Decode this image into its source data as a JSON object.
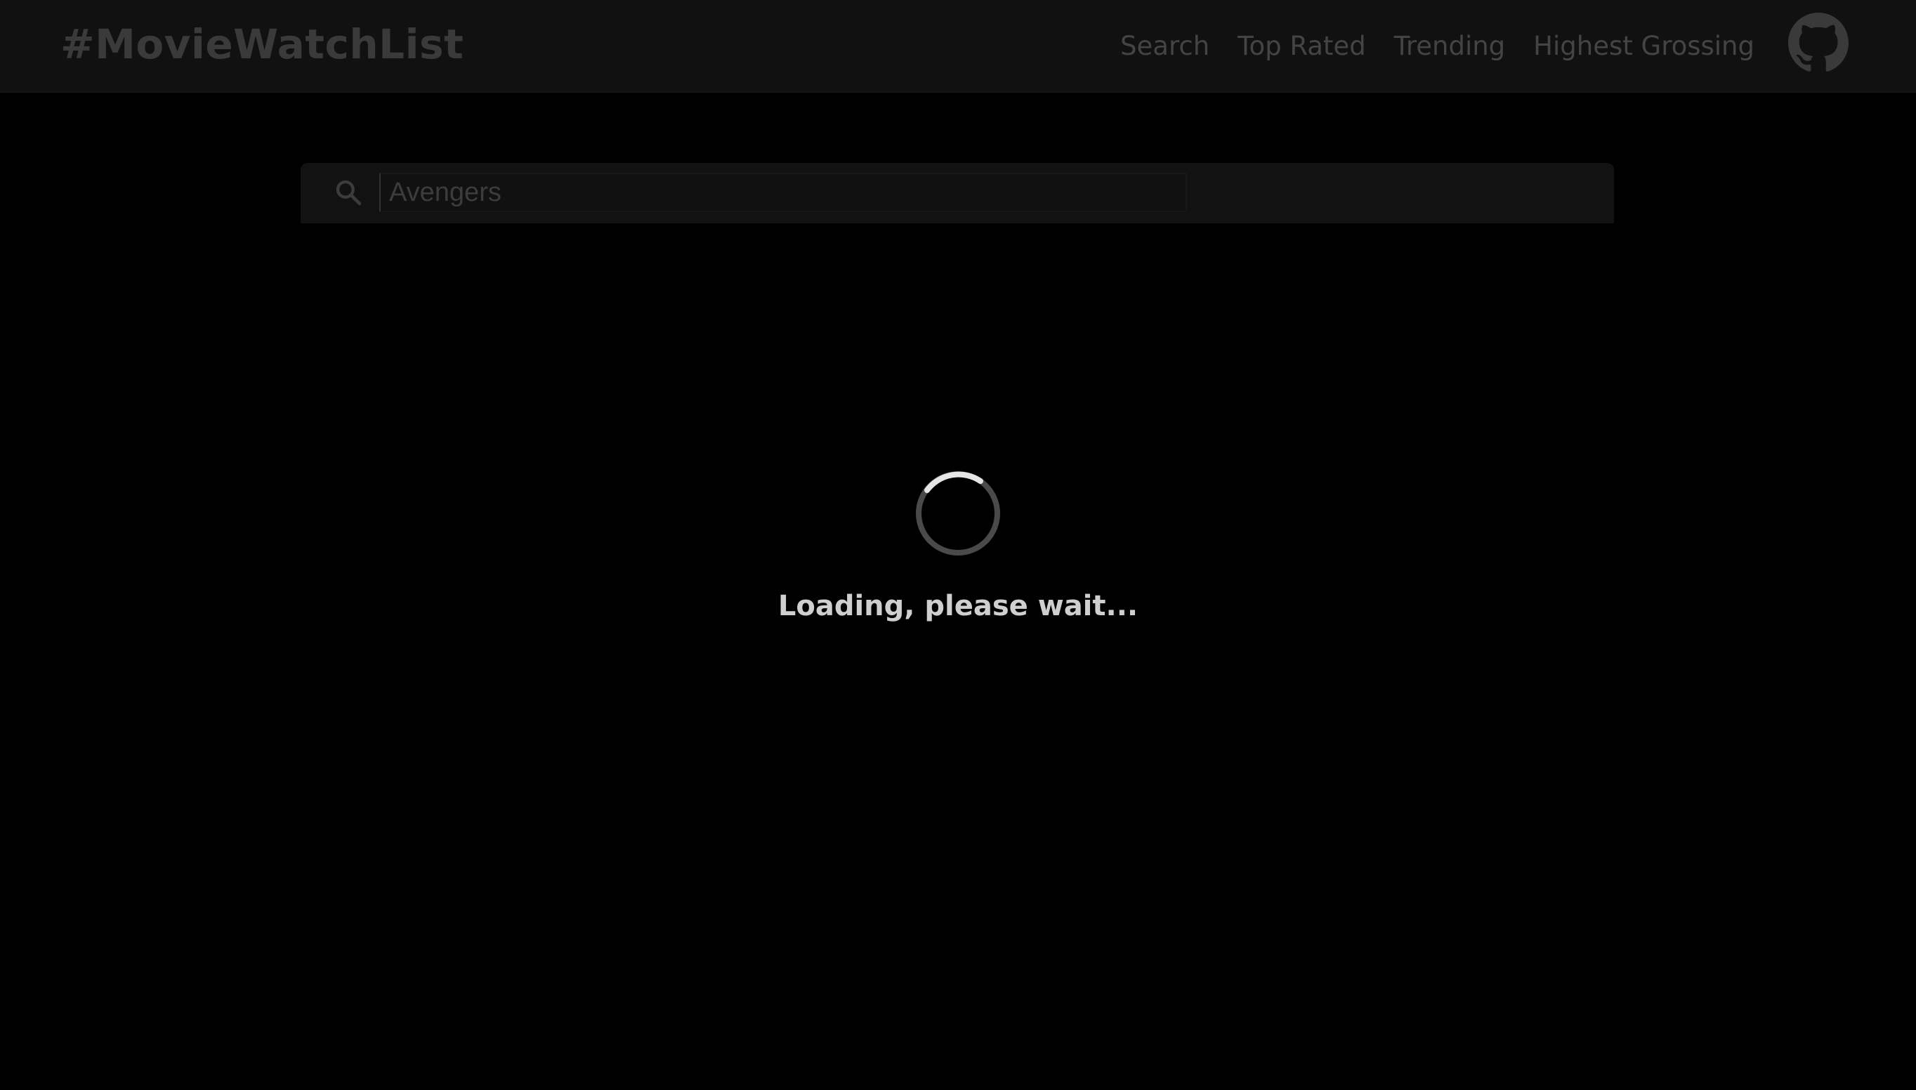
{
  "header": {
    "brand": "#MovieWatchList",
    "nav": [
      {
        "label": "Search"
      },
      {
        "label": "Top Rated"
      },
      {
        "label": "Trending"
      },
      {
        "label": "Highest Grossing"
      }
    ],
    "github_icon": "github-icon"
  },
  "search": {
    "icon": "search-icon",
    "value": "",
    "placeholder": "Avengers"
  },
  "loading": {
    "icon": "spinner-icon",
    "text": "Loading, please wait..."
  },
  "colors": {
    "background": "#000000",
    "topbar": "#111111",
    "muted_text": "#444444",
    "loading_text": "#cfcfcf"
  }
}
